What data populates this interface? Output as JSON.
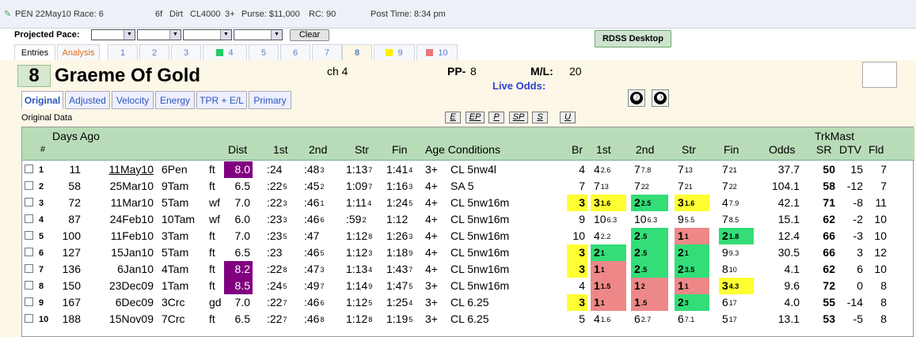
{
  "header": {
    "race": "PEN 22May10 Race: 6",
    "distance": "6f",
    "surface": "Dirt",
    "class": "CL4000",
    "age": "3+",
    "purse": "Purse: $11,000",
    "rc": "RC: 90",
    "post": "Post Time: 8:34 pm"
  },
  "pace": {
    "label": "Projected Pace:",
    "clear": "Clear"
  },
  "rdss": "RDSS Desktop",
  "tabs": [
    {
      "label": "Entries",
      "color": ""
    },
    {
      "label": "Analysis",
      "color": ""
    },
    {
      "label": "1",
      "color": ""
    },
    {
      "label": "2",
      "color": ""
    },
    {
      "label": "3",
      "color": ""
    },
    {
      "label": "4",
      "color": "#22cc66"
    },
    {
      "label": "5",
      "color": ""
    },
    {
      "label": "6",
      "color": ""
    },
    {
      "label": "7",
      "color": ""
    },
    {
      "label": "8",
      "color": ""
    },
    {
      "label": "9",
      "color": "#ffee00"
    },
    {
      "label": "10",
      "color": "#ee7777"
    }
  ],
  "horse": {
    "number": "8",
    "name": "Graeme Of Gold",
    "color_age": "ch 4",
    "pp_label": "PP-",
    "pp": "8",
    "ml_label": "M/L:",
    "ml": "20",
    "live_odds": "Live Odds:"
  },
  "circle_buttons": [
    "❷",
    "❸"
  ],
  "subtabs": [
    "Original",
    "Adjusted",
    "Velocity",
    "Energy",
    "TPR + E/L",
    "Primary"
  ],
  "original_data_label": "Original Data",
  "filter_buttons": [
    "E",
    "EP",
    "P",
    "SP",
    "S",
    "U"
  ],
  "columns": {
    "num": "#",
    "days_ago": "Days Ago",
    "dist": "Dist",
    "first": "1st",
    "second": "2nd",
    "str": "Str",
    "fin": "Fin",
    "age_cond": "Age Conditions",
    "br": "Br",
    "c1": "1st",
    "c2": "2nd",
    "cs": "Str",
    "cf": "Fin",
    "odds": "Odds",
    "trkmast": "TrkMast",
    "sr": "SR",
    "dtv": "DTV",
    "fld": "Fld"
  },
  "rows": [
    {
      "n": "1",
      "days": "11",
      "date": "11May10",
      "race": "6Pen",
      "cond": "ft",
      "dist": "8.0",
      "dist_hl": "pu",
      "q1": [
        ":24",
        ""
      ],
      "q2": [
        ":48",
        "3"
      ],
      "q3": [
        "1:13",
        "7"
      ],
      "q4": [
        "1:41",
        "4"
      ],
      "age": "3+",
      "conditions": "CL 5nw4l",
      "br": "4",
      "p1": [
        "4",
        "2.6"
      ],
      "p2": [
        "7",
        "7.8"
      ],
      "ps": [
        "7",
        "13"
      ],
      "pf": [
        "7",
        "21"
      ],
      "odds": "37.7",
      "sr": "50",
      "dtv": "15",
      "fld": "7",
      "hl": [
        "",
        "",
        "",
        "",
        "",
        ""
      ]
    },
    {
      "n": "2",
      "days": "58",
      "date": "25Mar10",
      "race": "9Tam",
      "cond": "ft",
      "dist": "6.5",
      "dist_hl": "",
      "q1": [
        ":22",
        "5"
      ],
      "q2": [
        ":45",
        "2"
      ],
      "q3": [
        "1:09",
        "7"
      ],
      "q4": [
        "1:16",
        "3"
      ],
      "age": "4+",
      "conditions": "SA 5",
      "br": "7",
      "p1": [
        "7",
        "13"
      ],
      "p2": [
        "7",
        "22"
      ],
      "ps": [
        "7",
        "21"
      ],
      "pf": [
        "7",
        "22"
      ],
      "odds": "104.1",
      "sr": "58",
      "dtv": "-12",
      "fld": "7",
      "hl": [
        "",
        "",
        "",
        "",
        "",
        ""
      ]
    },
    {
      "n": "3",
      "days": "72",
      "date": "11Mar10",
      "race": "5Tam",
      "cond": "wf",
      "dist": "7.0",
      "dist_hl": "",
      "q1": [
        ":22",
        "3"
      ],
      "q2": [
        ":46",
        "1"
      ],
      "q3": [
        "1:11",
        "4"
      ],
      "q4": [
        "1:24",
        "5"
      ],
      "age": "4+",
      "conditions": "CL 5nw16m",
      "br": "3",
      "p1": [
        "3",
        "1.6"
      ],
      "p2": [
        "2",
        "2.5"
      ],
      "ps": [
        "3",
        "1.6"
      ],
      "pf": [
        "4",
        "7.9"
      ],
      "odds": "42.1",
      "sr": "71",
      "dtv": "-8",
      "fld": "11",
      "hl": [
        "y",
        "y",
        "g",
        "y",
        "",
        ""
      ]
    },
    {
      "n": "4",
      "days": "87",
      "date": "24Feb10",
      "race": "10Tam",
      "cond": "wf",
      "dist": "6.0",
      "dist_hl": "",
      "q1": [
        ":23",
        "3"
      ],
      "q2": [
        ":46",
        "6"
      ],
      "q3": [
        ":59",
        "2"
      ],
      "q4": [
        "1:12",
        ""
      ],
      "age": "4+",
      "conditions": "CL 5nw16m",
      "br": "9",
      "p1": [
        "10",
        "6.3"
      ],
      "p2": [
        "10",
        "6.3"
      ],
      "ps": [
        "9",
        "5.5"
      ],
      "pf": [
        "7",
        "8.5"
      ],
      "odds": "15.1",
      "sr": "62",
      "dtv": "-2",
      "fld": "10",
      "hl": [
        "",
        "",
        "",
        "",
        "",
        ""
      ]
    },
    {
      "n": "5",
      "days": "100",
      "date": "11Feb10",
      "race": "3Tam",
      "cond": "ft",
      "dist": "7.0",
      "dist_hl": "",
      "q1": [
        ":23",
        "5"
      ],
      "q2": [
        ":47",
        ""
      ],
      "q3": [
        "1:12",
        "8"
      ],
      "q4": [
        "1:26",
        "3"
      ],
      "age": "4+",
      "conditions": "CL 5nw16m",
      "br": "10",
      "p1": [
        "4",
        "2.2"
      ],
      "p2": [
        "2",
        ".5"
      ],
      "ps": [
        "1",
        "1"
      ],
      "pf": [
        "2",
        "1.8"
      ],
      "odds": "12.4",
      "sr": "66",
      "dtv": "-3",
      "fld": "10",
      "hl": [
        "",
        "",
        "g",
        "p",
        "g",
        ""
      ]
    },
    {
      "n": "6",
      "days": "127",
      "date": "15Jan10",
      "race": "5Tam",
      "cond": "ft",
      "dist": "6.5",
      "dist_hl": "",
      "q1": [
        ":23",
        ""
      ],
      "q2": [
        ":46",
        "5"
      ],
      "q3": [
        "1:12",
        "3"
      ],
      "q4": [
        "1:18",
        "9"
      ],
      "age": "4+",
      "conditions": "CL 5nw16m",
      "br": "3",
      "p1": [
        "2",
        "1"
      ],
      "p2": [
        "2",
        ".5"
      ],
      "ps": [
        "2",
        "1"
      ],
      "pf": [
        "9",
        "9.3"
      ],
      "odds": "30.5",
      "sr": "66",
      "dtv": "3",
      "fld": "12",
      "hl": [
        "y",
        "g",
        "g",
        "g",
        "",
        ""
      ]
    },
    {
      "n": "7",
      "days": "136",
      "date": "6Jan10",
      "race": "4Tam",
      "cond": "ft",
      "dist": "8.2",
      "dist_hl": "pu",
      "q1": [
        ":22",
        "8"
      ],
      "q2": [
        ":47",
        "3"
      ],
      "q3": [
        "1:13",
        "4"
      ],
      "q4": [
        "1:43",
        "7"
      ],
      "age": "4+",
      "conditions": "CL 5nw16m",
      "br": "3",
      "p1": [
        "1",
        "1"
      ],
      "p2": [
        "2",
        ".5"
      ],
      "ps": [
        "2",
        "3.5"
      ],
      "pf": [
        "8",
        "10"
      ],
      "odds": "4.1",
      "sr": "62",
      "dtv": "6",
      "fld": "10",
      "hl": [
        "y",
        "p",
        "g",
        "g",
        "",
        ""
      ]
    },
    {
      "n": "8",
      "days": "150",
      "date": "23Dec09",
      "race": "1Tam",
      "cond": "ft",
      "dist": "8.5",
      "dist_hl": "pu",
      "q1": [
        ":24",
        "5"
      ],
      "q2": [
        ":49",
        "7"
      ],
      "q3": [
        "1:14",
        "9"
      ],
      "q4": [
        "1:47",
        "5"
      ],
      "age": "3+",
      "conditions": "CL 5nw16m",
      "br": "4",
      "p1": [
        "1",
        "1.5"
      ],
      "p2": [
        "1",
        "2"
      ],
      "ps": [
        "1",
        "1"
      ],
      "pf": [
        "3",
        "4.3"
      ],
      "odds": "9.6",
      "sr": "72",
      "dtv": "0",
      "fld": "8",
      "hl": [
        "",
        "p",
        "p",
        "p",
        "y",
        ""
      ]
    },
    {
      "n": "9",
      "days": "167",
      "date": "6Dec09",
      "race": "3Crc",
      "cond": "gd",
      "dist": "7.0",
      "dist_hl": "",
      "q1": [
        ":22",
        "7"
      ],
      "q2": [
        ":46",
        "6"
      ],
      "q3": [
        "1:12",
        "5"
      ],
      "q4": [
        "1:25",
        "4"
      ],
      "age": "3+",
      "conditions": "CL 6.25",
      "br": "3",
      "p1": [
        "1",
        "1"
      ],
      "p2": [
        "1",
        ".5"
      ],
      "ps": [
        "2",
        "3"
      ],
      "pf": [
        "6",
        "17"
      ],
      "odds": "4.0",
      "sr": "55",
      "dtv": "-14",
      "fld": "8",
      "hl": [
        "y",
        "p",
        "p",
        "g",
        "",
        ""
      ]
    },
    {
      "n": "10",
      "days": "188",
      "date": "15Nov09",
      "race": "7Crc",
      "cond": "ft",
      "dist": "6.5",
      "dist_hl": "",
      "q1": [
        ":22",
        "7"
      ],
      "q2": [
        ":46",
        "8"
      ],
      "q3": [
        "1:12",
        "8"
      ],
      "q4": [
        "1:19",
        "5"
      ],
      "age": "3+",
      "conditions": "CL 6.25",
      "br": "5",
      "p1": [
        "4",
        "1.6"
      ],
      "p2": [
        "6",
        "2.7"
      ],
      "ps": [
        "6",
        "7.1"
      ],
      "pf": [
        "5",
        "17"
      ],
      "odds": "13.1",
      "sr": "53",
      "dtv": "-5",
      "fld": "8",
      "hl": [
        "",
        "",
        "",
        "",
        "",
        ""
      ]
    }
  ]
}
